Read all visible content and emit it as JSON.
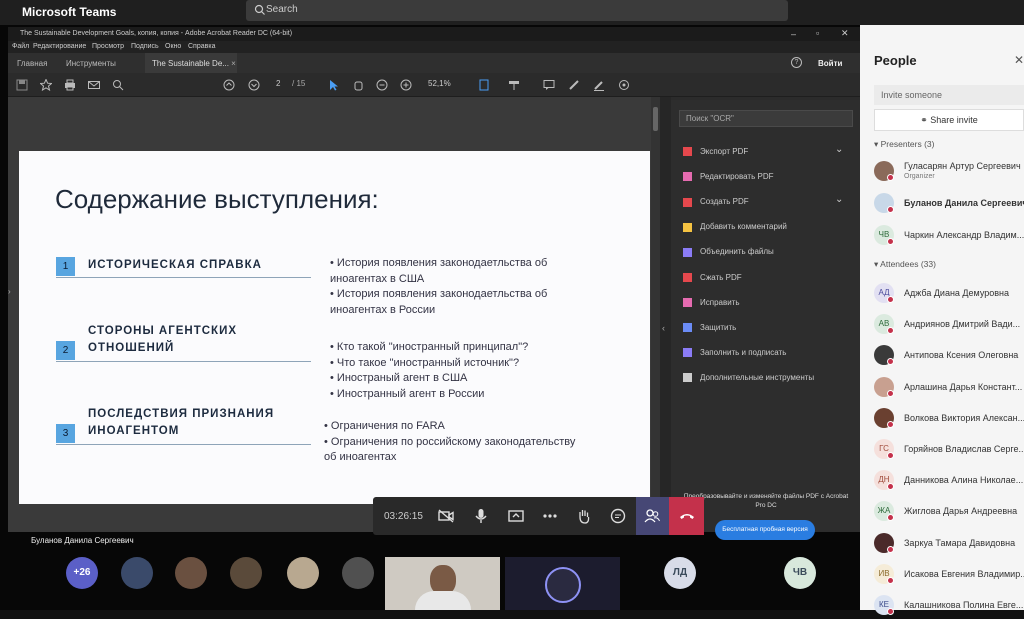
{
  "teams": {
    "title": "Microsoft Teams",
    "search_placeholder": "Search"
  },
  "acrobat": {
    "window_title": "The Sustainable Development Goals, копия, копия - Adobe Acrobat Reader DC (64-bit)",
    "menu": [
      "Файл",
      "Редактирование",
      "Просмотр",
      "Подпись",
      "Окно",
      "Справка"
    ],
    "tabs": {
      "home": "Главная",
      "tools": "Инструменты",
      "doc": "The Sustainable De..."
    },
    "sign_in": "Войти",
    "page_current": "2",
    "page_total": "/ 15",
    "zoom": "52,1%",
    "ocr_search": "Поиск \"OCR\"",
    "tools": [
      {
        "label": "Экспорт PDF",
        "color": "#e5484d"
      },
      {
        "label": "Редактировать PDF",
        "color": "#e56bb0"
      },
      {
        "label": "Создать PDF",
        "color": "#e5484d"
      },
      {
        "label": "Добавить комментарий",
        "color": "#f5c342"
      },
      {
        "label": "Объединить файлы",
        "color": "#8b7cf6"
      },
      {
        "label": "Сжать PDF",
        "color": "#e5484d"
      },
      {
        "label": "Исправить",
        "color": "#e56bb0"
      },
      {
        "label": "Защитить",
        "color": "#6b8cf6"
      },
      {
        "label": "Заполнить и подписать",
        "color": "#8b7cf6"
      },
      {
        "label": "Дополнительные инструменты",
        "color": "#cccccc"
      }
    ],
    "promo": "Преобразовывайте и изменяйте файлы PDF с Acrobat Pro DC",
    "trial_button": "Бесплатная пробная версия"
  },
  "slide": {
    "title": "Содержание выступления:",
    "sections": [
      {
        "num": "1",
        "heading_lines": [
          "ИСТОРИЧЕСКАЯ СПРАВКА"
        ]
      },
      {
        "num": "2",
        "heading_lines": [
          "СТОРОНЫ АГЕНТСКИХ",
          "ОТНОШЕНИЙ"
        ]
      },
      {
        "num": "3",
        "heading_lines": [
          "ПОСЛЕДСТВИЯ ПРИЗНАНИЯ",
          "ИНОАГЕНТОМ"
        ]
      }
    ],
    "bullets_1": [
      "• История появления законодаетльства об",
      "   иноагентах в США",
      "• История появления законодаетльства об",
      "   иноагентах в России"
    ],
    "bullets_2": [
      "• Кто такой \"иностранный принципал\"?",
      "• Что такое \"иностранный источник\"?",
      "• Иностраный агент в США",
      "• Иностранный агент в России"
    ],
    "bullets_3": [
      "• Ограничения по FARA",
      "• Ограничения по российскому законодательству",
      "   об иноагентах"
    ]
  },
  "call": {
    "timer": "03:26:15",
    "presenter": "Буланов Данила Сергеевич"
  },
  "gallery": [
    {
      "label": "+26",
      "color": "#5b5fc7"
    },
    {
      "label": "",
      "color": "#3a4a6a"
    },
    {
      "label": "",
      "color": "#6a5040"
    },
    {
      "label": "",
      "color": "#5a4a3a"
    },
    {
      "label": "",
      "color": "#b8a890"
    },
    {
      "label": "",
      "color": "#505050"
    },
    {
      "label": "ЛД",
      "color": "#d8dce8"
    },
    {
      "label": "ЧВ",
      "color": "#d8e8dc"
    }
  ],
  "people": {
    "title": "People",
    "invite_placeholder": "Invite someone",
    "share_invite": "Share invite",
    "presenters_label": "Presenters (3)",
    "attendees_label": "Attendees (33)",
    "presenters": [
      {
        "initials": "",
        "name": "Гуласарян Артур Сергеевич",
        "role": "Organizer",
        "bg": "#8a6a5a",
        "fg": "#fff",
        "bold": false
      },
      {
        "initials": "",
        "name": "Буланов Данила Сергеевич",
        "role": "",
        "bg": "#c8d8e8",
        "fg": "#333",
        "bold": true
      },
      {
        "initials": "ЧВ",
        "name": "Чаркин Александр Владим...",
        "role": "",
        "bg": "#dbeadf",
        "fg": "#2d6a3a",
        "bold": false
      }
    ],
    "attendees": [
      {
        "initials": "АД",
        "name": "Аджба Диана Демуровна",
        "bg": "#e2e0f2",
        "fg": "#4a4a9a"
      },
      {
        "initials": "АВ",
        "name": "Андриянов Дмитрий Вади...",
        "bg": "#dbeadf",
        "fg": "#2d6a3a"
      },
      {
        "initials": "",
        "name": "Антипова Ксения Олеговна",
        "bg": "#3a3a3a",
        "fg": "#fff"
      },
      {
        "initials": "",
        "name": "Арлашина Дарья Констант...",
        "bg": "#c8a090",
        "fg": "#fff"
      },
      {
        "initials": "",
        "name": "Волкова Виктория Алексан...",
        "bg": "#6a4030",
        "fg": "#fff"
      },
      {
        "initials": "ГС",
        "name": "Горяйнов Владислав Серге...",
        "bg": "#f5e0dc",
        "fg": "#a04a3a"
      },
      {
        "initials": "ДН",
        "name": "Данникова Алина Николае...",
        "bg": "#f5e0dc",
        "fg": "#a04a3a"
      },
      {
        "initials": "ЖА",
        "name": "Жиглова Дарья Андреевна",
        "bg": "#dbeadf",
        "fg": "#2d6a3a"
      },
      {
        "initials": "",
        "name": "Заркуа Тамара Давидовна",
        "bg": "#4a2a2a",
        "fg": "#fff"
      },
      {
        "initials": "ИВ",
        "name": "Исакова Евгения Владимир...",
        "bg": "#f5ecd8",
        "fg": "#8a6a2a"
      },
      {
        "initials": "КЕ",
        "name": "Калашникова Полина Евге...",
        "bg": "#dce4f2",
        "fg": "#3a4a8a"
      }
    ]
  }
}
